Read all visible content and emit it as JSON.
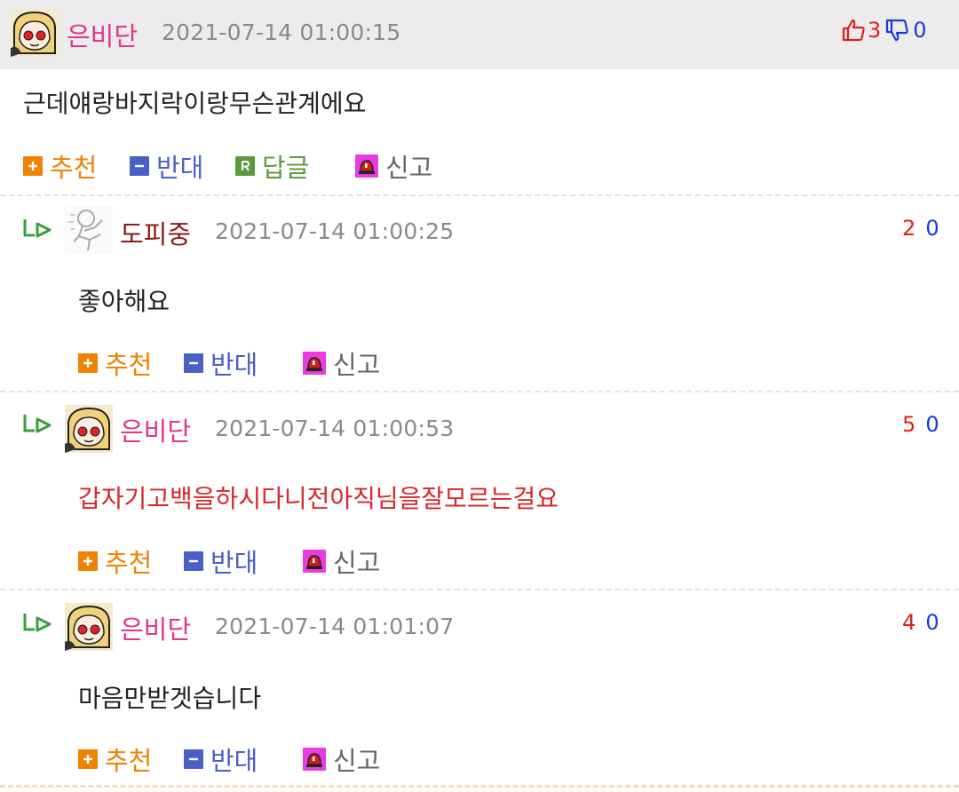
{
  "colors": {
    "nick_pink": "#e0358a",
    "nick_darkred": "#8b1a1a",
    "date_gray": "#8a8a8a",
    "recommend_orange": "#ef8200",
    "oppose_blue": "#4a60c4",
    "reply_green": "#5a9a3a",
    "report_magenta": "#e83ce0",
    "up_red": "#e0201c",
    "down_blue": "#1a3ad8",
    "highlight_red": "#d8262a"
  },
  "post": {
    "nickname": "은비단",
    "date": "2021-07-14 01:00:15",
    "up_count": "3",
    "down_count": "0",
    "text": "근데얘랑바지락이랑무슨관계에요",
    "actions": {
      "recommend": "추천",
      "oppose": "반대",
      "reply": "답글",
      "report": "신고"
    }
  },
  "replies": [
    {
      "nickname": "도피중",
      "date": "2021-07-14 01:00:25",
      "up": "2",
      "down": "0",
      "text": "좋아해요",
      "actions": {
        "recommend": "추천",
        "oppose": "반대",
        "report": "신고"
      }
    },
    {
      "nickname": "은비단",
      "date": "2021-07-14 01:00:53",
      "up": "5",
      "down": "0",
      "text": "갑자기고백을하시다니전아직님을잘모르는걸요",
      "actions": {
        "recommend": "추천",
        "oppose": "반대",
        "report": "신고"
      }
    },
    {
      "nickname": "은비단",
      "date": "2021-07-14 01:01:07",
      "up": "4",
      "down": "0",
      "text": "마음만받겟습니다",
      "actions": {
        "recommend": "추천",
        "oppose": "반대",
        "report": "신고"
      }
    }
  ],
  "icons": {
    "plus": "plus-icon",
    "minus": "minus-icon",
    "reply": "reply-r-icon",
    "report": "siren-icon",
    "thumb_up": "thumb-up-icon",
    "thumb_down": "thumb-down-icon",
    "reply_arrow": "reply-arrow-icon"
  }
}
